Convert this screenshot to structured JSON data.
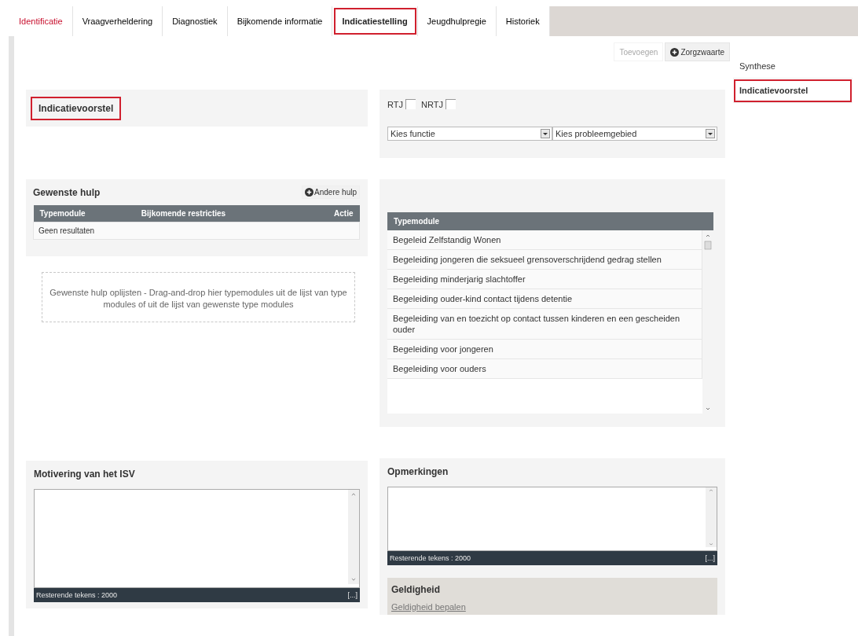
{
  "tabs": [
    {
      "label": "Identificatie",
      "selected": false,
      "highlighted": true
    },
    {
      "label": "Vraagverheldering",
      "selected": false,
      "highlighted": false
    },
    {
      "label": "Diagnostiek",
      "selected": false,
      "highlighted": false
    },
    {
      "label": "Bijkomende informatie",
      "selected": false,
      "highlighted": false
    },
    {
      "label": "Indicatiestelling",
      "selected": true,
      "highlighted": false
    },
    {
      "label": "Jeugdhulpregie",
      "selected": false,
      "highlighted": false
    },
    {
      "label": "Historiek",
      "selected": false,
      "highlighted": false
    }
  ],
  "toolbar": {
    "buttons": [
      {
        "label": "Toevoegen",
        "kind": "plain",
        "disabled": true
      },
      {
        "label": "Zorgzwaarte",
        "kind": "add",
        "disabled": false
      }
    ]
  },
  "sidebar": {
    "items": [
      {
        "label": "Synthese",
        "selected": false
      },
      {
        "label": "Indicatievoorstel",
        "selected": true
      }
    ]
  },
  "proposal": {
    "title": "Indicatievoorstel",
    "highlighted": true
  },
  "filters": {
    "checkboxes": [
      {
        "label": "RTJ",
        "checked": false
      },
      {
        "label": "NRTJ",
        "checked": false
      }
    ],
    "selects": [
      {
        "value": "Kies functie"
      },
      {
        "value": "Kies probleemgebied"
      }
    ]
  },
  "desired_help": {
    "title": "Gewenste hulp",
    "add_button": "Andere hulp",
    "columns": [
      "Typemodule",
      "Bijkomende restricties",
      "Actie"
    ],
    "empty_text": "Geen resultaten",
    "drop_hint": "Gewenste hulp oplijsten - Drag-and-drop hier typemodules uit de lijst van type modules of uit de lijst van gewenste type modules"
  },
  "modules": {
    "columns": [
      "Typemodule"
    ],
    "rows": [
      "Begeleid Zelfstandig Wonen",
      "Begeleiding jongeren die seksueel grensoverschrijdend gedrag stellen",
      "Begeleiding minderjarig slachtoffer",
      "Begeleiding ouder-kind contact tijdens detentie",
      "Begeleiding van en toezicht op contact tussen kinderen en een gescheiden ouder",
      "Begeleiding voor jongeren",
      "Begeleiding voor ouders"
    ]
  },
  "motivation": {
    "title": "Motivering van het ISV",
    "counter": "Resterende tekens : 2000",
    "expand": "[...]"
  },
  "remarks": {
    "title": "Opmerkingen",
    "counter": "Resterende tekens : 2000",
    "expand": "[...]"
  },
  "validity": {
    "title": "Geldigheid",
    "link": "Geldigheid bepalen"
  }
}
